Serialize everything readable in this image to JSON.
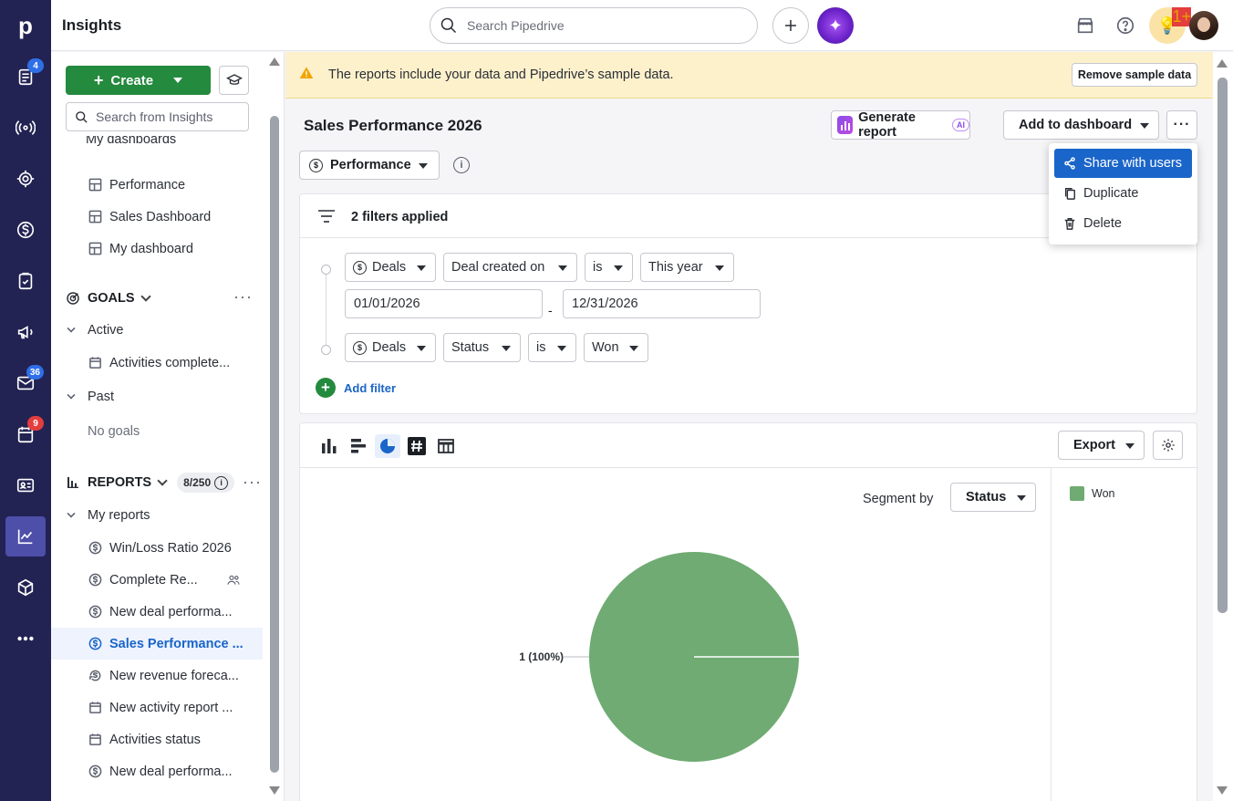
{
  "app": {
    "title": "Insights",
    "logo": "p",
    "search_placeholder": "Search Pipedrive",
    "colors": {
      "rail": "#222353",
      "accent": "#1a65c9",
      "create": "#248a3d",
      "pie": "#6fab73",
      "banner": "#fdf1cc"
    }
  },
  "rail": {
    "badges": {
      "leads": "4",
      "mail": "36",
      "calendar": "9"
    },
    "notif_badge": "1+"
  },
  "sidebar": {
    "create_label": "Create",
    "search_placeholder": "Search from Insights",
    "dashboards_header": "My dashboards",
    "dashboards": [
      "Performance",
      "Sales Dashboard",
      "My dashboard"
    ],
    "goals": {
      "title": "GOALS",
      "active_label": "Active",
      "active_items": [
        "Activities complete..."
      ],
      "past_label": "Past",
      "past_empty": "No goals"
    },
    "reports": {
      "title": "REPORTS",
      "count": "8/250",
      "my_reports_label": "My reports",
      "items": [
        "Win/Loss Ratio 2026",
        "Complete Re...",
        "New deal performa...",
        "Sales Performance ...",
        "New revenue foreca...",
        "New activity report ...",
        "Activities status",
        "New deal performa..."
      ]
    }
  },
  "banner": {
    "text": "The reports include your data and Pipedrive’s sample data.",
    "button": "Remove sample data"
  },
  "report": {
    "title": "Sales Performance 2026",
    "generate_label": "Generate report",
    "ai_tag": "AI",
    "add_dashboard_label": "Add to dashboard",
    "more_label": "···",
    "view_label": "Performance"
  },
  "menu": {
    "items": [
      "Share with users",
      "Duplicate",
      "Delete"
    ]
  },
  "filters": {
    "summary": "2 filters applied",
    "row1": {
      "entity": "Deals",
      "field": "Deal created on",
      "op": "is",
      "value": "This year",
      "from": "01/01/2026",
      "sep": "-",
      "to": "12/31/2026"
    },
    "row2": {
      "entity": "Deals",
      "field": "Status",
      "op": "is",
      "value": "Won"
    },
    "add_label": "Add filter"
  },
  "chart": {
    "export_label": "Export",
    "segment_label": "Segment by",
    "segment_value": "Status"
  },
  "chart_data": {
    "type": "pie",
    "slices": [
      {
        "name": "Won",
        "value": 1,
        "percent": 100,
        "label": "1 (100%)"
      }
    ],
    "legend": [
      "Won"
    ],
    "legend_position": "right"
  }
}
